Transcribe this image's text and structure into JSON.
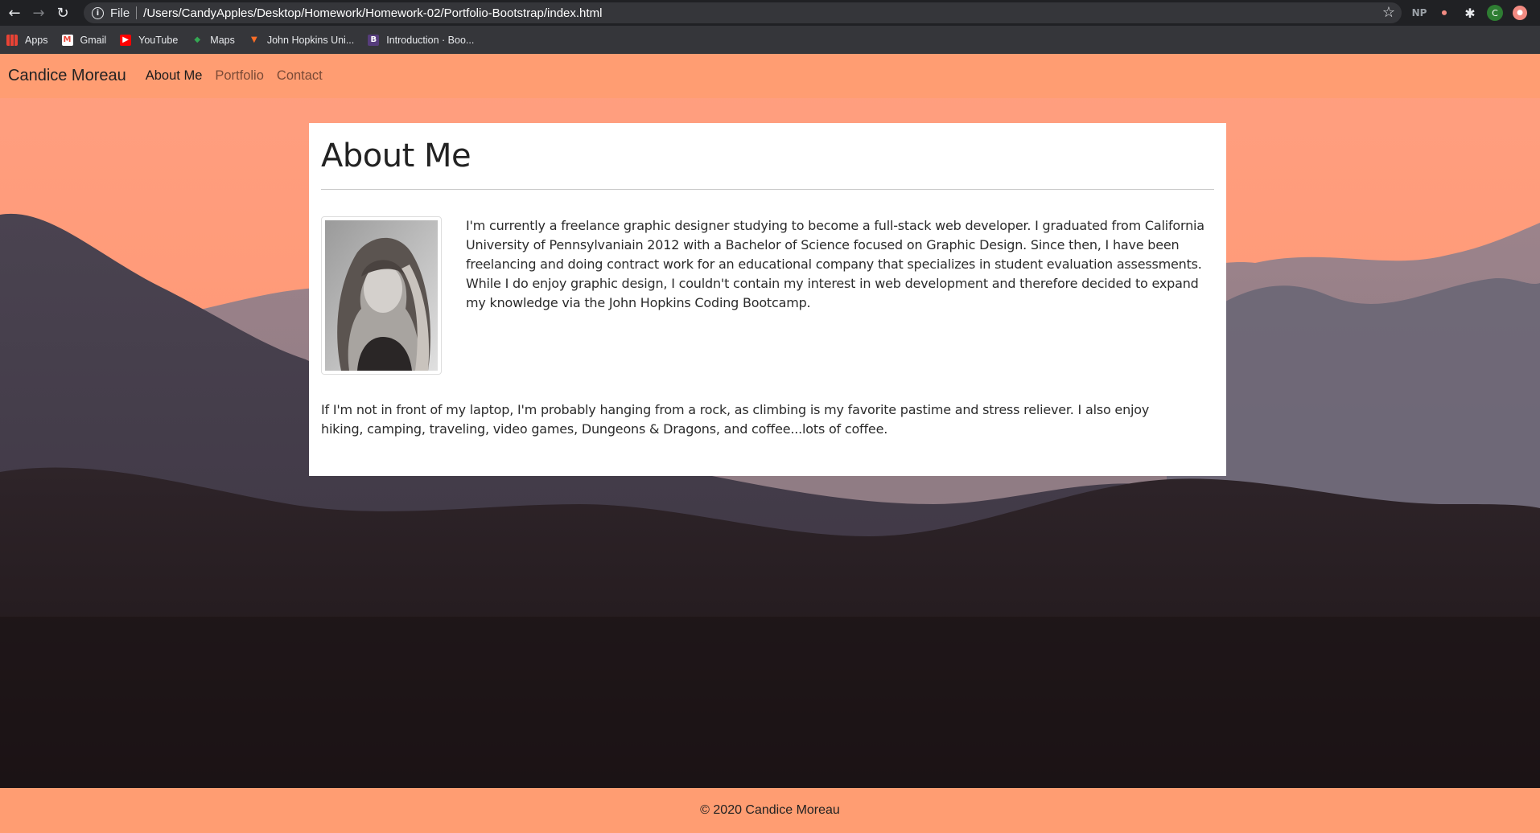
{
  "browser": {
    "back_icon": "arrow-left-icon",
    "forward_icon": "arrow-right-icon",
    "reload_icon": "reload-icon",
    "scheme_label": "File",
    "url": "/Users/CandyApples/Desktop/Homework/Homework-02/Portfolio-Bootstrap/index.html",
    "extensions": {
      "np_label": "NP",
      "avatar_letter": "C"
    },
    "bookmarks": [
      {
        "label": "Apps",
        "icon": "apps-grid-icon"
      },
      {
        "label": "Gmail",
        "icon": "gmail-icon"
      },
      {
        "label": "YouTube",
        "icon": "youtube-icon"
      },
      {
        "label": "Maps",
        "icon": "maps-icon"
      },
      {
        "label": "John Hopkins Uni...",
        "icon": "gitlab-icon"
      },
      {
        "label": "Introduction · Boo...",
        "icon": "bootstrap-icon"
      }
    ]
  },
  "site": {
    "brand": "Candice Moreau",
    "nav": [
      {
        "label": "About Me",
        "active": true
      },
      {
        "label": "Portfolio",
        "active": false
      },
      {
        "label": "Contact",
        "active": false
      }
    ],
    "about": {
      "heading": "About Me",
      "bio": "I'm currently a freelance graphic designer studying to become a full-stack web developer. I graduated from California University of Pennsylvaniain 2012 with a Bachelor of Science focused on Graphic Design. Since then, I have been freelancing and doing contract work for an educational company that specializes in student evaluation assessments. While I do enjoy graphic design, I couldn't contain my interest in web development and therefore decided to expand my knowledge via the John Hopkins Coding Bootcamp.",
      "hobbies": "If I'm not in front of my laptop, I'm probably hanging from a rock, as climbing is my favorite pastime and stress reliever. I also enjoy hiking, camping, traveling, video games, Dungeons & Dragons, and coffee...lots of coffee."
    },
    "footer": "© 2020 Candice Moreau"
  },
  "colors": {
    "accent": "#ff9d72",
    "chrome_dark": "#202124",
    "chrome_mid": "#35363a"
  }
}
